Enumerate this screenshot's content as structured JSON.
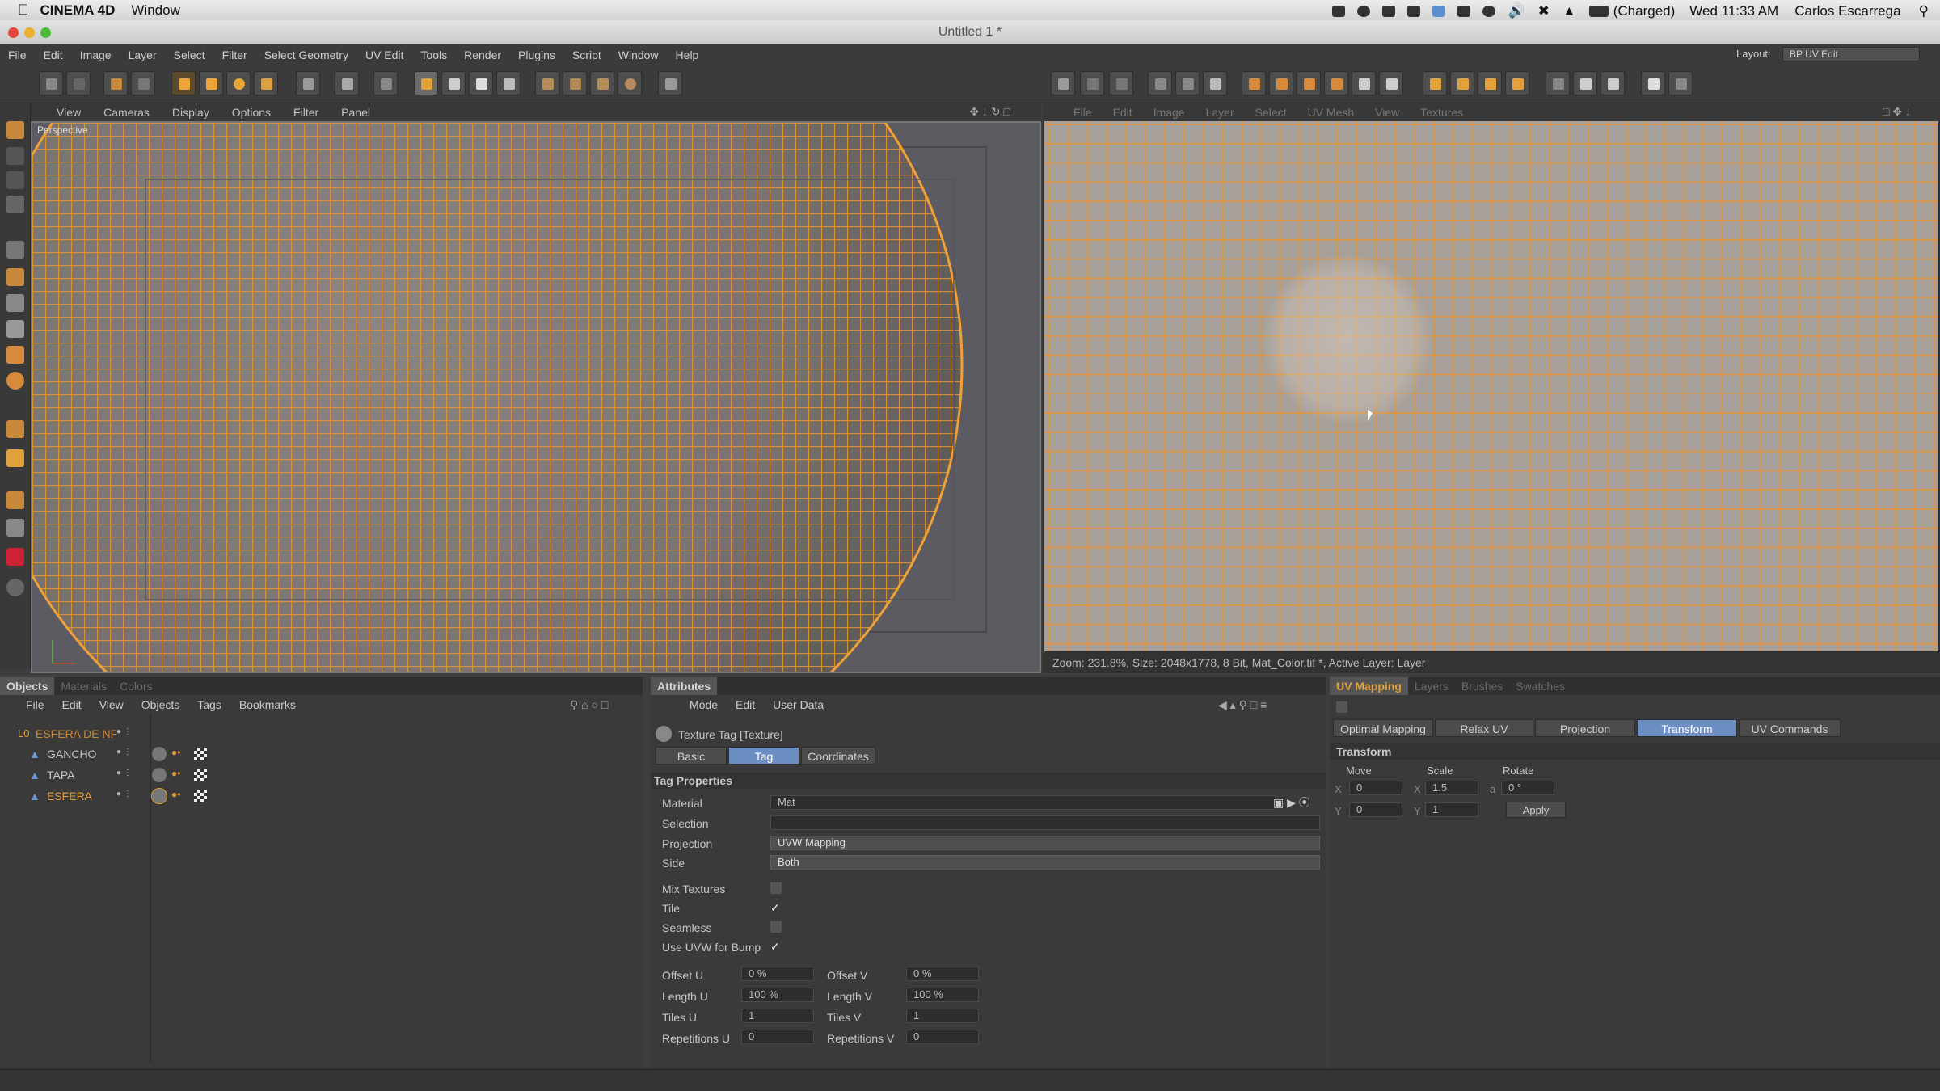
{
  "mac_menubar": {
    "app": "CINEMA 4D",
    "menu": "Window",
    "battery": "(Charged)",
    "clock": "Wed 11:33 AM",
    "user": "Carlos Escarrega"
  },
  "window": {
    "title": "Untitled 1 *"
  },
  "app_menu": {
    "items": [
      "File",
      "Edit",
      "Image",
      "Layer",
      "Select",
      "Filter",
      "Select Geometry",
      "UV Edit",
      "Tools",
      "Render",
      "Plugins",
      "Script",
      "Window",
      "Help"
    ],
    "layout_label": "Layout:",
    "layout_value": "BP UV Edit"
  },
  "viewport": {
    "menu": [
      "View",
      "Cameras",
      "Display",
      "Options",
      "Filter",
      "Panel"
    ],
    "label": "Perspective"
  },
  "uv_editor": {
    "menu": [
      "File",
      "Edit",
      "Image",
      "Layer",
      "Select",
      "UV Mesh",
      "View",
      "Textures"
    ],
    "status": "Zoom: 231.8%, Size: 2048x1778, 8 Bit, Mat_Color.tif *, Active Layer: Layer"
  },
  "objects_panel": {
    "tabs": [
      "Objects",
      "Materials",
      "Colors"
    ],
    "menu": [
      "File",
      "Edit",
      "View",
      "Objects",
      "Tags",
      "Bookmarks"
    ],
    "items": [
      {
        "name": "ESFERA DE NF",
        "color": "#e0a03b"
      },
      {
        "name": "GANCHO",
        "color": "#c8c8c8"
      },
      {
        "name": "TAPA",
        "color": "#c8c8c8"
      },
      {
        "name": "ESFERA",
        "color": "#e0a03b"
      }
    ]
  },
  "attributes_panel": {
    "tab": "Attributes",
    "menu": [
      "Mode",
      "Edit",
      "User Data"
    ],
    "title": "Texture Tag [Texture]",
    "subtabs": [
      "Basic",
      "Tag",
      "Coordinates"
    ],
    "section": "Tag Properties",
    "material_label": "Material",
    "material_value": "Mat",
    "selection_label": "Selection",
    "projection_label": "Projection",
    "projection_value": "UVW Mapping",
    "side_label": "Side",
    "side_value": "Both",
    "mix_label": "Mix Textures",
    "tile_label": "Tile",
    "seamless_label": "Seamless",
    "uvw_bump_label": "Use UVW for Bump",
    "offset_u_label": "Offset U",
    "offset_u": "0 %",
    "offset_v_label": "Offset V",
    "offset_v": "0 %",
    "length_u_label": "Length U",
    "length_u": "100 %",
    "length_v_label": "Length V",
    "length_v": "100 %",
    "tiles_u_label": "Tiles U",
    "tiles_u": "1",
    "tiles_v_label": "Tiles V",
    "tiles_v": "1",
    "rep_u_label": "Repetitions U",
    "rep_u": "0",
    "rep_v_label": "Repetitions V",
    "rep_v": "0"
  },
  "uv_tools": {
    "tabs": [
      "UV Mapping",
      "Layers",
      "Brushes",
      "Swatches"
    ],
    "buttons": [
      "Optimal Mapping",
      "Relax UV",
      "Projection",
      "Transform",
      "UV Commands"
    ],
    "section": "Transform",
    "move_label": "Move",
    "scale_label": "Scale",
    "rotate_label": "Rotate",
    "x": "X",
    "y": "Y",
    "a": "a",
    "move_x": "0",
    "move_y": "0",
    "scale_x": "1.5",
    "scale_y": "1",
    "rotate_a": "0 °",
    "apply": "Apply"
  }
}
